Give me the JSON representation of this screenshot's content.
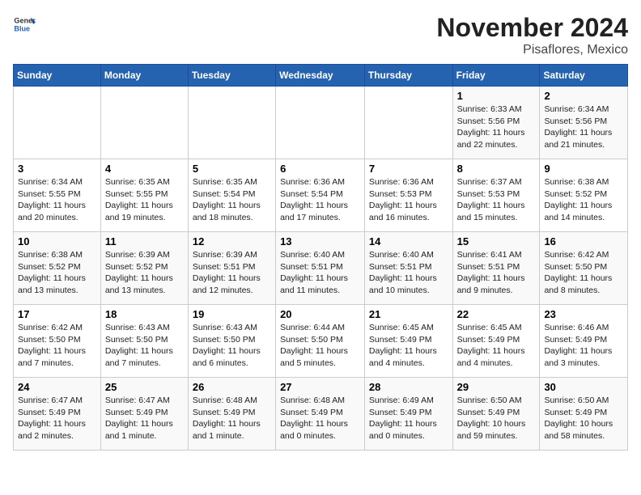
{
  "header": {
    "logo_general": "General",
    "logo_blue": "Blue",
    "month": "November 2024",
    "location": "Pisaflores, Mexico"
  },
  "days_of_week": [
    "Sunday",
    "Monday",
    "Tuesday",
    "Wednesday",
    "Thursday",
    "Friday",
    "Saturday"
  ],
  "weeks": [
    [
      {
        "day": "",
        "info": ""
      },
      {
        "day": "",
        "info": ""
      },
      {
        "day": "",
        "info": ""
      },
      {
        "day": "",
        "info": ""
      },
      {
        "day": "",
        "info": ""
      },
      {
        "day": "1",
        "info": "Sunrise: 6:33 AM\nSunset: 5:56 PM\nDaylight: 11 hours\nand 22 minutes."
      },
      {
        "day": "2",
        "info": "Sunrise: 6:34 AM\nSunset: 5:56 PM\nDaylight: 11 hours\nand 21 minutes."
      }
    ],
    [
      {
        "day": "3",
        "info": "Sunrise: 6:34 AM\nSunset: 5:55 PM\nDaylight: 11 hours\nand 20 minutes."
      },
      {
        "day": "4",
        "info": "Sunrise: 6:35 AM\nSunset: 5:55 PM\nDaylight: 11 hours\nand 19 minutes."
      },
      {
        "day": "5",
        "info": "Sunrise: 6:35 AM\nSunset: 5:54 PM\nDaylight: 11 hours\nand 18 minutes."
      },
      {
        "day": "6",
        "info": "Sunrise: 6:36 AM\nSunset: 5:54 PM\nDaylight: 11 hours\nand 17 minutes."
      },
      {
        "day": "7",
        "info": "Sunrise: 6:36 AM\nSunset: 5:53 PM\nDaylight: 11 hours\nand 16 minutes."
      },
      {
        "day": "8",
        "info": "Sunrise: 6:37 AM\nSunset: 5:53 PM\nDaylight: 11 hours\nand 15 minutes."
      },
      {
        "day": "9",
        "info": "Sunrise: 6:38 AM\nSunset: 5:52 PM\nDaylight: 11 hours\nand 14 minutes."
      }
    ],
    [
      {
        "day": "10",
        "info": "Sunrise: 6:38 AM\nSunset: 5:52 PM\nDaylight: 11 hours\nand 13 minutes."
      },
      {
        "day": "11",
        "info": "Sunrise: 6:39 AM\nSunset: 5:52 PM\nDaylight: 11 hours\nand 13 minutes."
      },
      {
        "day": "12",
        "info": "Sunrise: 6:39 AM\nSunset: 5:51 PM\nDaylight: 11 hours\nand 12 minutes."
      },
      {
        "day": "13",
        "info": "Sunrise: 6:40 AM\nSunset: 5:51 PM\nDaylight: 11 hours\nand 11 minutes."
      },
      {
        "day": "14",
        "info": "Sunrise: 6:40 AM\nSunset: 5:51 PM\nDaylight: 11 hours\nand 10 minutes."
      },
      {
        "day": "15",
        "info": "Sunrise: 6:41 AM\nSunset: 5:51 PM\nDaylight: 11 hours\nand 9 minutes."
      },
      {
        "day": "16",
        "info": "Sunrise: 6:42 AM\nSunset: 5:50 PM\nDaylight: 11 hours\nand 8 minutes."
      }
    ],
    [
      {
        "day": "17",
        "info": "Sunrise: 6:42 AM\nSunset: 5:50 PM\nDaylight: 11 hours\nand 7 minutes."
      },
      {
        "day": "18",
        "info": "Sunrise: 6:43 AM\nSunset: 5:50 PM\nDaylight: 11 hours\nand 7 minutes."
      },
      {
        "day": "19",
        "info": "Sunrise: 6:43 AM\nSunset: 5:50 PM\nDaylight: 11 hours\nand 6 minutes."
      },
      {
        "day": "20",
        "info": "Sunrise: 6:44 AM\nSunset: 5:50 PM\nDaylight: 11 hours\nand 5 minutes."
      },
      {
        "day": "21",
        "info": "Sunrise: 6:45 AM\nSunset: 5:49 PM\nDaylight: 11 hours\nand 4 minutes."
      },
      {
        "day": "22",
        "info": "Sunrise: 6:45 AM\nSunset: 5:49 PM\nDaylight: 11 hours\nand 4 minutes."
      },
      {
        "day": "23",
        "info": "Sunrise: 6:46 AM\nSunset: 5:49 PM\nDaylight: 11 hours\nand 3 minutes."
      }
    ],
    [
      {
        "day": "24",
        "info": "Sunrise: 6:47 AM\nSunset: 5:49 PM\nDaylight: 11 hours\nand 2 minutes."
      },
      {
        "day": "25",
        "info": "Sunrise: 6:47 AM\nSunset: 5:49 PM\nDaylight: 11 hours\nand 1 minute."
      },
      {
        "day": "26",
        "info": "Sunrise: 6:48 AM\nSunset: 5:49 PM\nDaylight: 11 hours\nand 1 minute."
      },
      {
        "day": "27",
        "info": "Sunrise: 6:48 AM\nSunset: 5:49 PM\nDaylight: 11 hours\nand 0 minutes."
      },
      {
        "day": "28",
        "info": "Sunrise: 6:49 AM\nSunset: 5:49 PM\nDaylight: 11 hours\nand 0 minutes."
      },
      {
        "day": "29",
        "info": "Sunrise: 6:50 AM\nSunset: 5:49 PM\nDaylight: 10 hours\nand 59 minutes."
      },
      {
        "day": "30",
        "info": "Sunrise: 6:50 AM\nSunset: 5:49 PM\nDaylight: 10 hours\nand 58 minutes."
      }
    ]
  ]
}
